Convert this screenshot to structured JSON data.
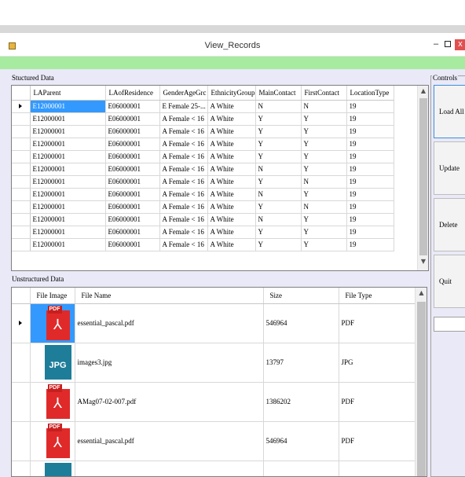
{
  "window": {
    "title": "View_Records",
    "min_glyph": "–",
    "close_glyph": "x",
    "accent_strip_color": "#a6eb9f",
    "client_bg": "#e9e9f7"
  },
  "structured": {
    "title": "Stuctured Data",
    "columns": [
      "LAParent",
      "LAofResidence",
      "GenderAgeGrc",
      "EthnicityGroup",
      "MainContact",
      "FirstContact",
      "LocationType"
    ],
    "rows": [
      [
        "E12000001",
        "E06000001",
        "E Female 25-...",
        "A White",
        "N",
        "N",
        "19"
      ],
      [
        "E12000001",
        "E06000001",
        "A Female < 16",
        "A White",
        "Y",
        "Y",
        "19"
      ],
      [
        "E12000001",
        "E06000001",
        "A Female < 16",
        "A White",
        "Y",
        "Y",
        "19"
      ],
      [
        "E12000001",
        "E06000001",
        "A Female < 16",
        "A White",
        "Y",
        "Y",
        "19"
      ],
      [
        "E12000001",
        "E06000001",
        "A Female < 16",
        "A White",
        "Y",
        "Y",
        "19"
      ],
      [
        "E12000001",
        "E06000001",
        "A Female < 16",
        "A White",
        "N",
        "Y",
        "19"
      ],
      [
        "E12000001",
        "E06000001",
        "A Female < 16",
        "A White",
        "Y",
        "N",
        "19"
      ],
      [
        "E12000001",
        "E06000001",
        "A Female < 16",
        "A White",
        "N",
        "Y",
        "19"
      ],
      [
        "E12000001",
        "E06000001",
        "A Female < 16",
        "A White",
        "Y",
        "N",
        "19"
      ],
      [
        "E12000001",
        "E06000001",
        "A Female < 16",
        "A White",
        "N",
        "Y",
        "19"
      ],
      [
        "E12000001",
        "E06000001",
        "A Female < 16",
        "A White",
        "Y",
        "Y",
        "19"
      ],
      [
        "E12000001",
        "E06000001",
        "A Female < 16",
        "A White",
        "Y",
        "Y",
        "19"
      ]
    ],
    "selected_cell_color": "#3399ff"
  },
  "unstructured": {
    "title": "Unstructured Data",
    "columns": [
      "File Image",
      "File Name",
      "Size",
      "File Type"
    ],
    "rows": [
      {
        "icon": "pdf-icon",
        "icon_tag": "PDF",
        "name": "essential_pascal.pdf",
        "size": "546964",
        "type": "PDF"
      },
      {
        "icon": "jpg-icon",
        "icon_tag": "JPG",
        "name": "images3.jpg",
        "size": "13797",
        "type": "JPG"
      },
      {
        "icon": "pdf-icon",
        "icon_tag": "PDF",
        "name": "AMag07-02-007.pdf",
        "size": "1386202",
        "type": "PDF"
      },
      {
        "icon": "pdf-icon",
        "icon_tag": "PDF",
        "name": "essential_pascal.pdf",
        "size": "546964",
        "type": "PDF"
      },
      {
        "icon": "jpg-icon",
        "icon_tag": "",
        "name": "",
        "size": "",
        "type": ""
      }
    ]
  },
  "controls": {
    "title": "Controls",
    "buttons": [
      "Load All",
      "Update",
      "Delete",
      "Quit"
    ]
  }
}
